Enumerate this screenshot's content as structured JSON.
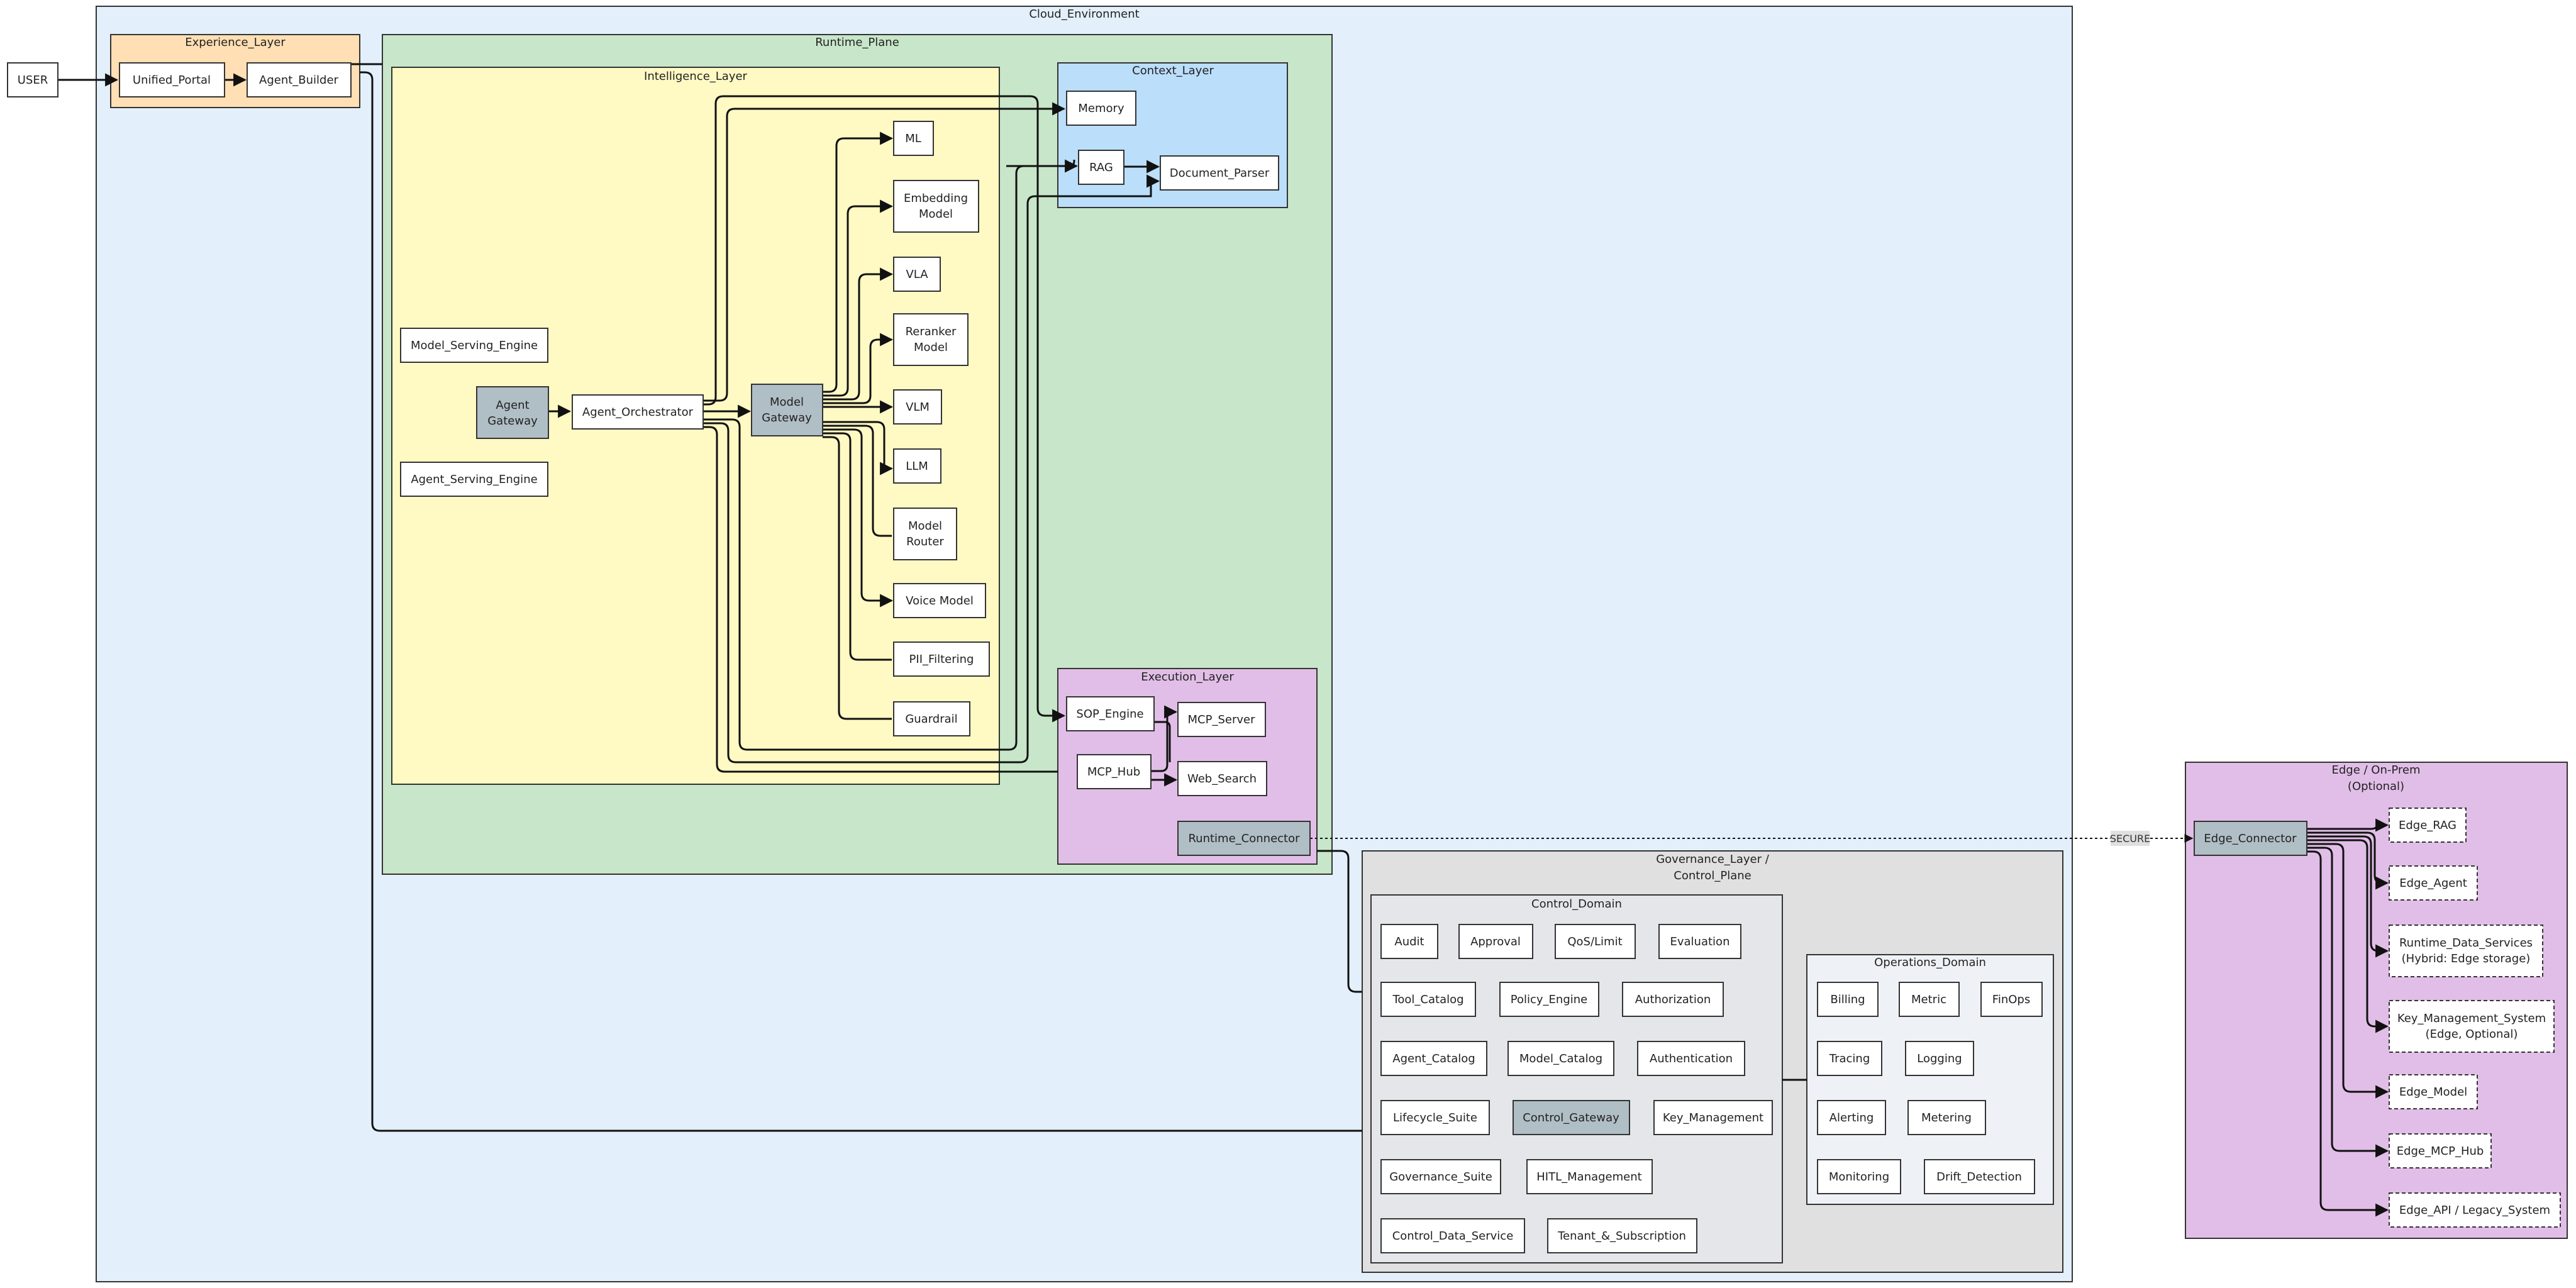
{
  "title": "Cloud_Environment",
  "colors": {
    "cloud": "#e3f0fc",
    "experience": "#ffdfb3",
    "runtime": "#c8e6c9",
    "intelligence": "#fff9c4",
    "context": "#bbdefb",
    "execution": "#e1bee7",
    "governance": "#e0e0e0",
    "control": "#e4e6ea",
    "operations": "#eef2f6",
    "edge": "#e1bee7",
    "gray_node": "#b0bec5"
  },
  "user": "USER",
  "groups": {
    "experience": "Experience_Layer",
    "runtime": "Runtime_Plane",
    "intelligence": "Intelligence_Layer",
    "context": "Context_Layer",
    "execution": "Execution_Layer",
    "governance_1": "Governance_Layer /",
    "governance_2": "Control_Plane",
    "control": "Control_Domain",
    "operations": "Operations_Domain",
    "edge_1": "Edge / On-Prem",
    "edge_2": "(Optional)"
  },
  "nodes": {
    "unified_portal": "Unified_Portal",
    "agent_builder": "Agent_Builder",
    "model_serving_engine": "Model_Serving_Engine",
    "agent_serving_engine": "Agent_Serving_Engine",
    "agent_gateway_1": "Agent",
    "agent_gateway_2": "Gateway",
    "agent_orchestrator": "Agent_Orchestrator",
    "model_gateway_1": "Model",
    "model_gateway_2": "Gateway",
    "ml": "ML",
    "embedding_1": "Embedding",
    "embedding_2": "Model",
    "vla": "VLA",
    "reranker_1": "Reranker",
    "reranker_2": "Model",
    "vlm": "VLM",
    "llm": "LLM",
    "router_1": "Model",
    "router_2": "Router",
    "voice_model": "Voice Model",
    "pii_filtering": "PII_Filtering",
    "guardrail": "Guardrail",
    "memory": "Memory",
    "rag": "RAG",
    "document_parser": "Document_Parser",
    "sop_engine": "SOP_Engine",
    "mcp_server": "MCP_Server",
    "mcp_hub": "MCP_Hub",
    "web_search": "Web_Search",
    "runtime_connector": "Runtime_Connector",
    "audit": "Audit",
    "approval": "Approval",
    "qos_limit": "QoS/Limit",
    "evaluation": "Evaluation",
    "tool_catalog": "Tool_Catalog",
    "policy_engine": "Policy_Engine",
    "authorization": "Authorization",
    "agent_catalog": "Agent_Catalog",
    "model_catalog": "Model_Catalog",
    "authentication": "Authentication",
    "lifecycle_suite": "Lifecycle_Suite",
    "control_gateway": "Control_Gateway",
    "key_management": "Key_Management",
    "governance_suite": "Governance_Suite",
    "hitl_management": "HITL_Management",
    "control_data_service": "Control_Data_Service",
    "tenant_subscription": "Tenant_&_Subscription",
    "billing": "Billing",
    "metric": "Metric",
    "finops": "FinOps",
    "tracing": "Tracing",
    "logging": "Logging",
    "alerting": "Alerting",
    "metering": "Metering",
    "monitoring": "Monitoring",
    "drift_detection": "Drift_Detection",
    "edge_connector": "Edge_Connector",
    "edge_rag": "Edge_RAG",
    "edge_agent": "Edge_Agent",
    "runtime_data_1": "Runtime_Data_Services",
    "runtime_data_2": "(Hybrid: Edge storage)",
    "kms_1": "Key_Management_System",
    "kms_2": "(Edge, Optional)",
    "edge_model": "Edge_Model",
    "edge_mcp_hub": "Edge_MCP_Hub",
    "edge_api": "Edge_API / Legacy_System"
  },
  "edge_label": "SECURE"
}
